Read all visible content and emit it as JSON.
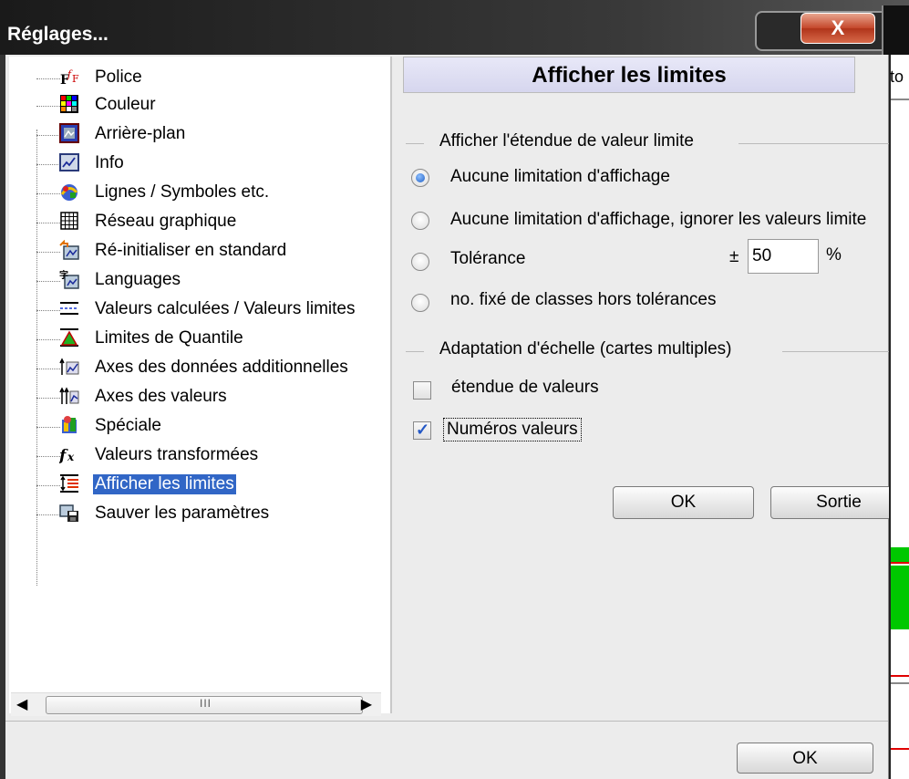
{
  "window": {
    "title": "Réglages...",
    "close_glyph": "X"
  },
  "tree": {
    "items": [
      {
        "label": "Police",
        "icon": "font-icon"
      },
      {
        "label": "Couleur",
        "icon": "palette-icon"
      },
      {
        "label": "Arrière-plan",
        "icon": "background-image-icon"
      },
      {
        "label": "Info",
        "icon": "info-chart-icon"
      },
      {
        "label": "Lignes / Symboles etc.",
        "icon": "lines-symbols-icon"
      },
      {
        "label": "Réseau graphique",
        "icon": "grid-icon"
      },
      {
        "label": "Ré-initialiser en standard",
        "icon": "reset-icon"
      },
      {
        "label": "Languages",
        "icon": "languages-icon"
      },
      {
        "label": "Valeurs calculées / Valeurs limites",
        "icon": "limit-lines-icon"
      },
      {
        "label": "Limites de Quantile",
        "icon": "quantile-icon"
      },
      {
        "label": "Axes des données additionnelles",
        "icon": "additional-axes-icon"
      },
      {
        "label": "Axes des valeurs",
        "icon": "value-axes-icon"
      },
      {
        "label": "Spéciale",
        "icon": "special-icon"
      },
      {
        "label": "Valeurs transformées",
        "icon": "function-icon"
      },
      {
        "label": "Afficher les limites",
        "icon": "show-limits-icon",
        "selected": true
      },
      {
        "label": "Sauver les paramètres",
        "icon": "save-settings-icon"
      }
    ],
    "scroll_grip": "III"
  },
  "panel": {
    "header": "Afficher les limites",
    "group1": {
      "title": "Afficher l'étendue de valeur limite",
      "options": [
        {
          "label": "Aucune limitation d'affichage",
          "checked": true
        },
        {
          "label": "Aucune limitation d'affichage, ignorer les valeurs limite",
          "checked": false
        },
        {
          "label": "Tolérance",
          "checked": false
        },
        {
          "label": "no. fixé de classes hors tolérances",
          "checked": false
        }
      ],
      "tolerance_prefix": "±",
      "tolerance_value": "50",
      "tolerance_unit": "%"
    },
    "group2": {
      "title": "Adaptation d'échelle (cartes multiples)",
      "checkboxes": [
        {
          "label": "étendue de valeurs",
          "checked": false
        },
        {
          "label": "Numéros valeurs",
          "checked": true
        }
      ]
    },
    "ok_label": "OK",
    "exit_label": "Sortie"
  },
  "footer": {
    "ok_label": "OK"
  },
  "background_app": {
    "edge_text": "to"
  },
  "colors": {
    "selection": "#3166c6",
    "radio_checked": "#1f5fc4",
    "edge_green": "#00c800",
    "edge_red": "#e00000"
  }
}
